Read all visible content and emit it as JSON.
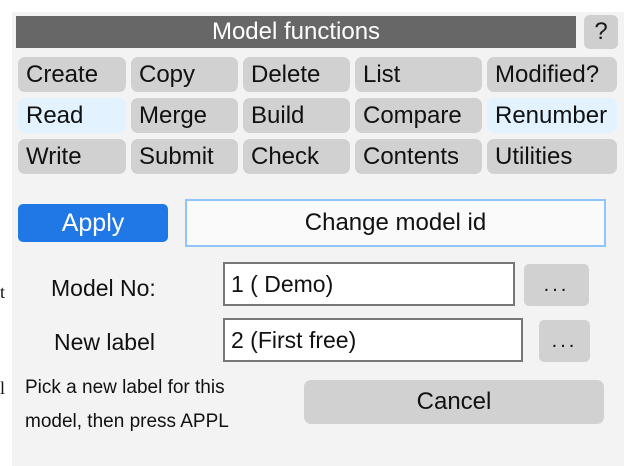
{
  "window": {
    "title": "Model functions",
    "help_label": "?"
  },
  "functions": [
    {
      "label": "Create",
      "selected": false
    },
    {
      "label": "Copy",
      "selected": false
    },
    {
      "label": "Delete",
      "selected": false
    },
    {
      "label": "List",
      "selected": false
    },
    {
      "label": "Modified?",
      "selected": false
    },
    {
      "label": "Read",
      "selected": true
    },
    {
      "label": "Merge",
      "selected": false
    },
    {
      "label": "Build",
      "selected": false
    },
    {
      "label": "Compare",
      "selected": false
    },
    {
      "label": "Renumber",
      "selected": true
    },
    {
      "label": "Write",
      "selected": false
    },
    {
      "label": "Submit",
      "selected": false
    },
    {
      "label": "Check",
      "selected": false
    },
    {
      "label": "Contents",
      "selected": false
    },
    {
      "label": "Utilities",
      "selected": false
    }
  ],
  "action": {
    "apply_label": "Apply",
    "mode_label": "Change model id"
  },
  "fields": {
    "model_no_label": "Model No:",
    "model_no_value": "1 ( Demo)",
    "new_label_label": "New label",
    "new_label_value": "2 (First free)",
    "browse_label": "..."
  },
  "hint": {
    "line1": "Pick a new label for this",
    "line2": "model, then press APPL"
  },
  "buttons": {
    "cancel_label": "Cancel"
  },
  "edge_fragments": {
    "row1": "t",
    "row3": "l"
  },
  "colors": {
    "title_bar": "#676767",
    "button": "#d1d1d1",
    "selected_button": "#e2f2ff",
    "apply": "#1f78e6",
    "mode_border": "#8fc5ff"
  }
}
